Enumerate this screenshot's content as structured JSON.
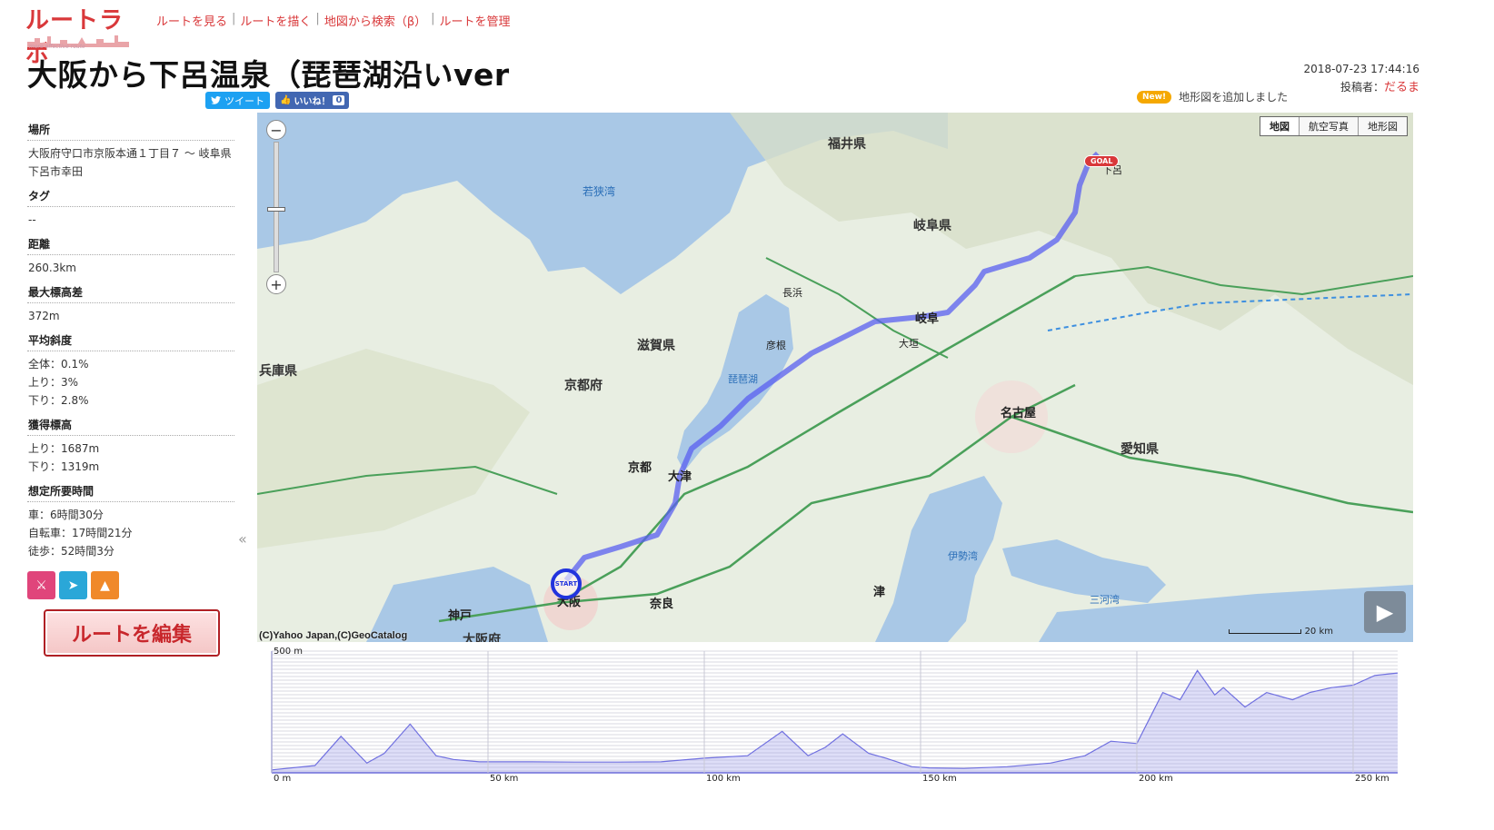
{
  "header": {
    "logo_text": "ルートラボ",
    "logo_tagline": "more effective route",
    "nav": [
      "ルートを見る",
      "ルートを描く",
      "地図から検索（β）",
      "ルートを管理"
    ]
  },
  "route": {
    "title": "大阪から下呂温泉（琵琶湖沿いver",
    "date": "2018-07-23 17:44:16",
    "author_label": "投稿者：",
    "author": "だるま"
  },
  "news": {
    "badge": "New!",
    "text": "地形図を追加しました"
  },
  "social": {
    "tweet": "ツイート",
    "like": "いいね！",
    "like_count": "0"
  },
  "sidebar": {
    "location_label": "場所",
    "location": "大阪府守口市京阪本通１丁目７ 〜 岐阜県下呂市幸田",
    "tags_label": "タグ",
    "tags": "--",
    "distance_label": "距離",
    "distance": "260.3km",
    "max_elev_diff_label": "最大標高差",
    "max_elev_diff": "372m",
    "slope_label": "平均斜度",
    "slope_total": "全体：0.1%",
    "slope_up": "上り：3%",
    "slope_down": "下り：2.8%",
    "gain_label": "獲得標高",
    "gain_up": "上り：1687m",
    "gain_down": "下り：1319m",
    "time_label": "想定所要時間",
    "time_car": "車：6時間30分",
    "time_bike": "自転車：17時間21分",
    "time_walk": "徒歩：52時間3分",
    "collapse_icon": "double-chevron-left-icon"
  },
  "edit_button": "ルートを編集",
  "map": {
    "types": [
      "地図",
      "航空写真",
      "地形図"
    ],
    "active_type": "地図",
    "copyright": "(C)Yahoo Japan,(C)GeoCatalog",
    "scale_label": "20 km",
    "goal_label": "GOAL",
    "start_label": "START",
    "zoom_in": "+",
    "zoom_out": "−",
    "labels": {
      "fukui": "福井県",
      "gifu_pref": "岐阜県",
      "shiga": "滋賀県",
      "kyoto_pref": "京都府",
      "hyogo": "兵庫県",
      "aichi": "愛知県",
      "osaka_pref": "大阪府",
      "wakasa": "若狭湾",
      "biwako": "琵琶湖",
      "ise": "伊勢湾",
      "mikawa": "三河湾",
      "kyoto": "京都",
      "otsu": "大津",
      "osaka": "大阪",
      "kobe": "神戸",
      "nara": "奈良",
      "tsu": "津",
      "gifu": "岐阜",
      "nagoya": "名古屋",
      "gero": "下呂",
      "hikone": "彦根",
      "ogaki": "大垣",
      "nagahama": "長浜"
    }
  },
  "chart_data": {
    "type": "area",
    "title": "",
    "xlabel": "",
    "ylabel": "",
    "xlim": [
      0,
      260.3
    ],
    "ylim": [
      0,
      500
    ],
    "y_tick_label": "500 m",
    "x_ticks": [
      "0 m",
      "50 km",
      "100 km",
      "150 km",
      "200 km",
      "250 km"
    ],
    "x_tick_values": [
      0,
      50,
      100,
      150,
      200,
      250
    ],
    "x": [
      0,
      10,
      16,
      22,
      26,
      32,
      38,
      42,
      48,
      50,
      60,
      70,
      80,
      90,
      100,
      110,
      118,
      124,
      128,
      132,
      138,
      142,
      148,
      152,
      160,
      170,
      180,
      188,
      194,
      200,
      206,
      210,
      214,
      218,
      220,
      225,
      230,
      236,
      240,
      245,
      250,
      255,
      260.3
    ],
    "values": [
      12,
      30,
      150,
      40,
      80,
      200,
      70,
      55,
      45,
      45,
      45,
      44,
      44,
      45,
      60,
      70,
      170,
      70,
      105,
      160,
      80,
      60,
      25,
      20,
      18,
      25,
      40,
      70,
      130,
      120,
      330,
      300,
      420,
      320,
      350,
      270,
      330,
      300,
      330,
      350,
      360,
      400,
      410
    ]
  }
}
